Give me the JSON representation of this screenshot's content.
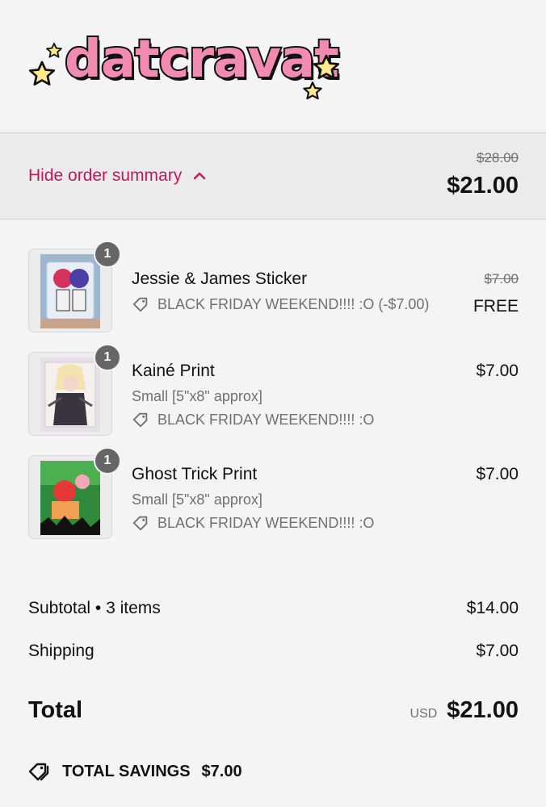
{
  "brand": {
    "name": "datcravat"
  },
  "summary": {
    "toggle_label": "Hide order summary",
    "original_total": "$28.00",
    "total": "$21.00"
  },
  "items": [
    {
      "qty": "1",
      "name": "Jessie & James Sticker",
      "variant": "",
      "discount": "BLACK FRIDAY WEEKEND!!!! :O (-$7.00)",
      "original_price": "$7.00",
      "price": "FREE"
    },
    {
      "qty": "1",
      "name": "Kainé Print",
      "variant": "Small [5\"x8\" approx]",
      "discount": "BLACK FRIDAY WEEKEND!!!! :O",
      "original_price": "",
      "price": "$7.00"
    },
    {
      "qty": "1",
      "name": "Ghost Trick Print",
      "variant": "Small [5\"x8\" approx]",
      "discount": "BLACK FRIDAY WEEKEND!!!! :O",
      "original_price": "",
      "price": "$7.00"
    }
  ],
  "totals": {
    "subtotal_label": "Subtotal • 3 items",
    "subtotal_value": "$14.00",
    "shipping_label": "Shipping",
    "shipping_value": "$7.00",
    "total_label": "Total",
    "currency": "USD",
    "total_value": "$21.00",
    "savings_label": "TOTAL SAVINGS",
    "savings_value": "$7.00"
  },
  "colors": {
    "accent": "#c2185b",
    "logo_pink": "#f28bb1",
    "star_yellow": "#ffe98a"
  },
  "icons": {
    "toggle": "chevron-up-icon",
    "discount": "tag-icon",
    "savings": "tags-icon"
  }
}
